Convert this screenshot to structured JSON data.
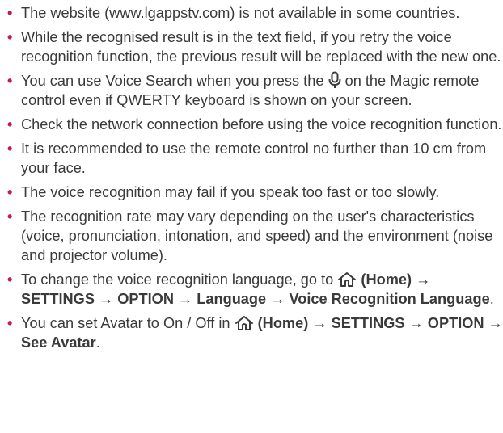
{
  "items": [
    {
      "text": "The website (www.lgappstv.com) is not available in some countries."
    },
    {
      "text": "While the recognised result is in the text field, if you retry the voice recognition function, the previous result will be replaced with the new one."
    },
    {
      "before": "You can use Voice Search when you press the",
      "icon": "microphone-icon",
      "after": "on the Magic remote control even if QWERTY keyboard is shown on your screen."
    },
    {
      "text": "Check the network connection before using the voice recognition function."
    },
    {
      "text": "It is recommended to use the remote control no further than 10 cm from your face."
    },
    {
      "text": "The voice recognition may fail if you speak too fast or too slowly."
    },
    {
      "text": "The recognition rate may vary depending on the user's characteristics (voice, pronunciation, intonation, and speed) and the environment (noise and projector volume)."
    },
    {
      "before": "To change the voice recognition language, go to",
      "icon": "home-icon",
      "path": "(Home) → SETTINGS → OPTION → Language → Voice Recognition Language",
      "after": "."
    },
    {
      "before": "You can set Avatar to On / Off in",
      "icon": "home-icon",
      "path": "(Home) → SETTINGS → OPTION → See Avatar",
      "after": "."
    }
  ],
  "bullet_color": "#c0185a",
  "text_color": "#3a3a3a"
}
